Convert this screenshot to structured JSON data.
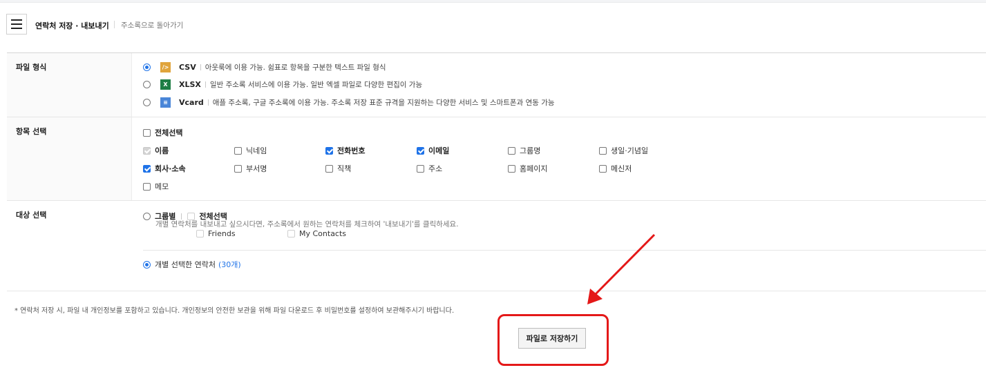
{
  "header": {
    "menu_icon": "hamburger-menu-icon",
    "title": "연락처 저장 · 내보내기",
    "back_link": "주소록으로 돌아가기"
  },
  "file_format": {
    "label": "파일 형식",
    "options": [
      {
        "name": "CSV",
        "icon": "csv-file-icon",
        "icon_text": "/>",
        "description": "아웃룩에 이용 가능. 쉼표로 항목을 구분한 텍스트 파일 형식",
        "selected": true
      },
      {
        "name": "XLSX",
        "icon": "excel-file-icon",
        "icon_text": "X",
        "description": "일반 주소록 서비스에 이용 가능. 일반 엑셀 파일로 다양한 편집이 가능",
        "selected": false
      },
      {
        "name": "Vcard",
        "icon": "vcard-file-icon",
        "icon_text": "≡",
        "description": "애플 주소록, 구글 주소록에 이용 가능. 주소록 저장 표준 규격을 지원하는 다양한 서비스 및 스마트폰과 연동 가능",
        "selected": false
      }
    ]
  },
  "field_select": {
    "label": "항목 선택",
    "select_all": "전체선택",
    "fields": [
      {
        "label": "이름",
        "checked": true,
        "disabled": true
      },
      {
        "label": "닉네임",
        "checked": false
      },
      {
        "label": "전화번호",
        "checked": true
      },
      {
        "label": "이메일",
        "checked": true
      },
      {
        "label": "그룹명",
        "checked": false
      },
      {
        "label": "생일·기념일",
        "checked": false
      },
      {
        "label": "회사·소속",
        "checked": true
      },
      {
        "label": "부서명",
        "checked": false
      },
      {
        "label": "직책",
        "checked": false
      },
      {
        "label": "주소",
        "checked": false
      },
      {
        "label": "홈페이지",
        "checked": false
      },
      {
        "label": "메신저",
        "checked": false
      },
      {
        "label": "메모",
        "checked": false
      }
    ]
  },
  "target_select": {
    "label": "대상 선택",
    "by_group": "그룹별",
    "group_select_all": "전체선택",
    "groups": [
      "Friends",
      "My Contacts"
    ],
    "individual": "개별 선택한 연락처",
    "individual_count": "(30개)",
    "individual_help": "개별 연락처를 내보내고 싶으시다면, 주소록에서 원하는 연락처를 체크하여 '내보내기'를 클릭하세요."
  },
  "notice": "* 연락처 저장 시, 파일 내 개인정보를 포함하고 있습니다. 개인정보의 안전한 보관을 위해 파일 다운로드 후 비밀번호를 설정하여 보관해주시기 바랍니다.",
  "save_button": "파일로 저장하기",
  "colors": {
    "accent": "#1f73e8",
    "annotation": "#e41818"
  }
}
